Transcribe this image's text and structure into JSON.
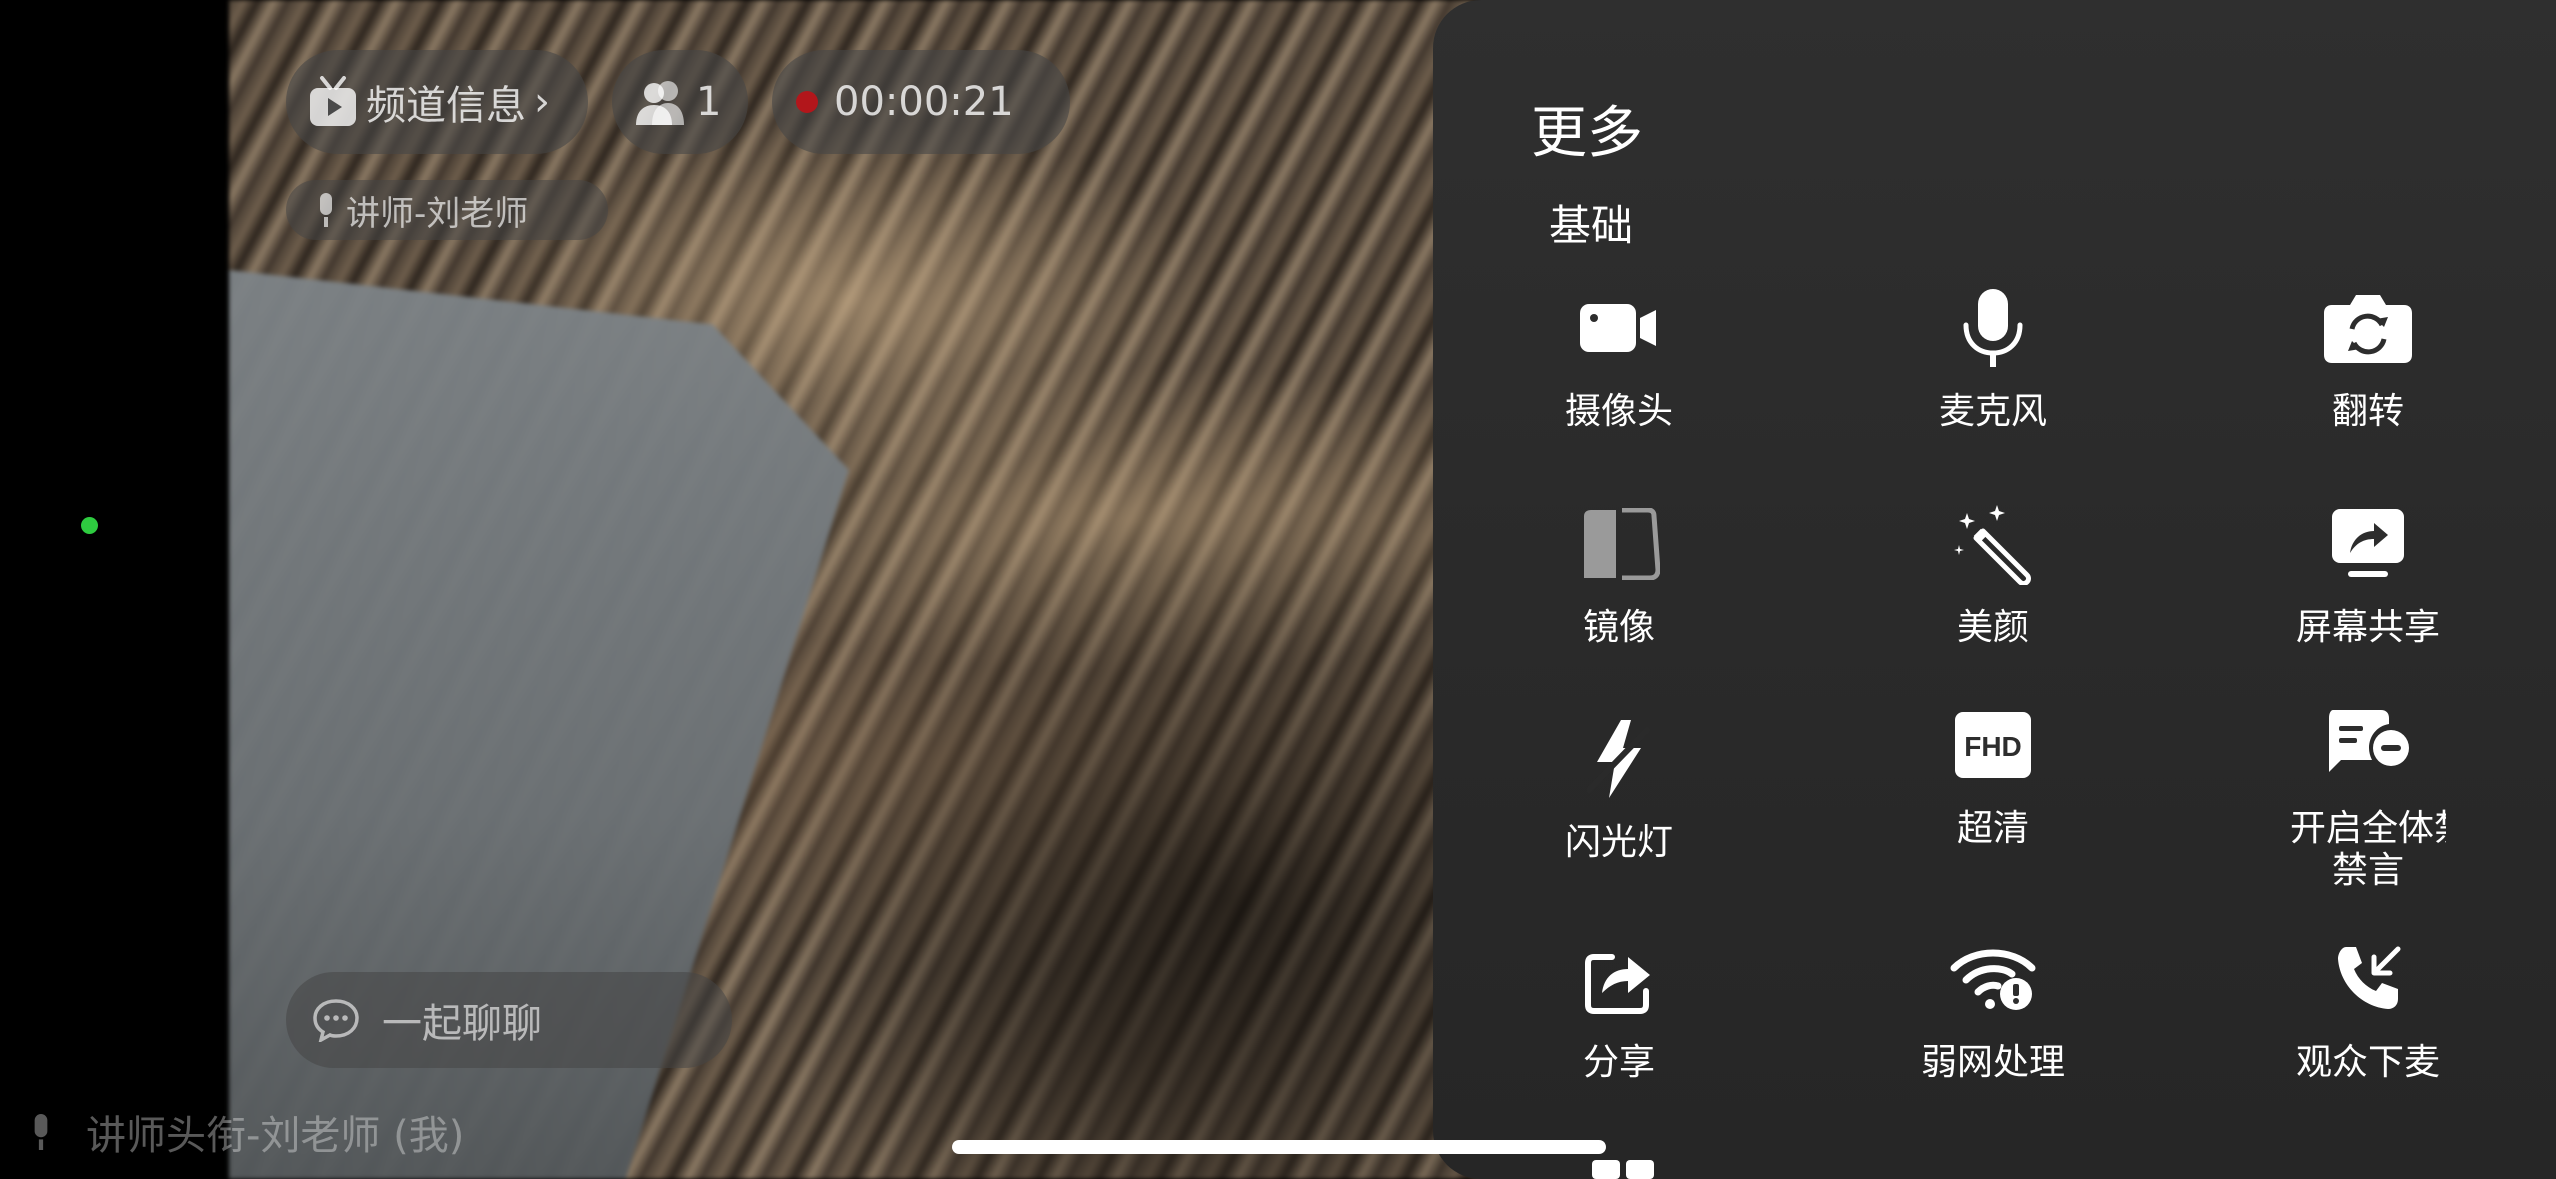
{
  "header": {
    "channel_label": "频道信息",
    "channel_icon": "tv-icon",
    "chevron_icon": "chevron-right-icon",
    "member_count": "1",
    "member_icon": "users-icon",
    "recording_time": "00:00:21",
    "recording_color": "#b2161b"
  },
  "speaker": {
    "label": "讲师-刘老师",
    "icon": "mic-icon"
  },
  "chat": {
    "placeholder": "一起聊聊",
    "icon": "chat-bubble-icon"
  },
  "bottom_speaker": {
    "label": "讲师头衔-刘老师 (我)"
  },
  "status": {
    "indicator_color": "#2ecc40"
  },
  "panel": {
    "title": "更多",
    "section": "基础",
    "items": [
      {
        "label": "摄像头",
        "icon": "camera-icon"
      },
      {
        "label": "麦克风",
        "icon": "microphone-icon"
      },
      {
        "label": "翻转",
        "icon": "flip-camera-icon"
      },
      {
        "label": "镜像",
        "icon": "mirror-icon"
      },
      {
        "label": "美颜",
        "icon": "magic-wand-icon"
      },
      {
        "label": "屏幕共享",
        "icon": "screen-share-icon"
      },
      {
        "label": "闪光灯",
        "icon": "flash-icon"
      },
      {
        "label": "超清",
        "icon": "fhd-icon",
        "badge": "FHD"
      },
      {
        "label": "开启全体禁言",
        "label_line2": "禁言",
        "icon": "mute-all-chat-icon"
      },
      {
        "label": "分享",
        "icon": "share-icon"
      },
      {
        "label": "弱网处理",
        "icon": "weak-network-icon"
      },
      {
        "label": "观众下麦",
        "icon": "hang-up-audience-icon"
      }
    ]
  }
}
